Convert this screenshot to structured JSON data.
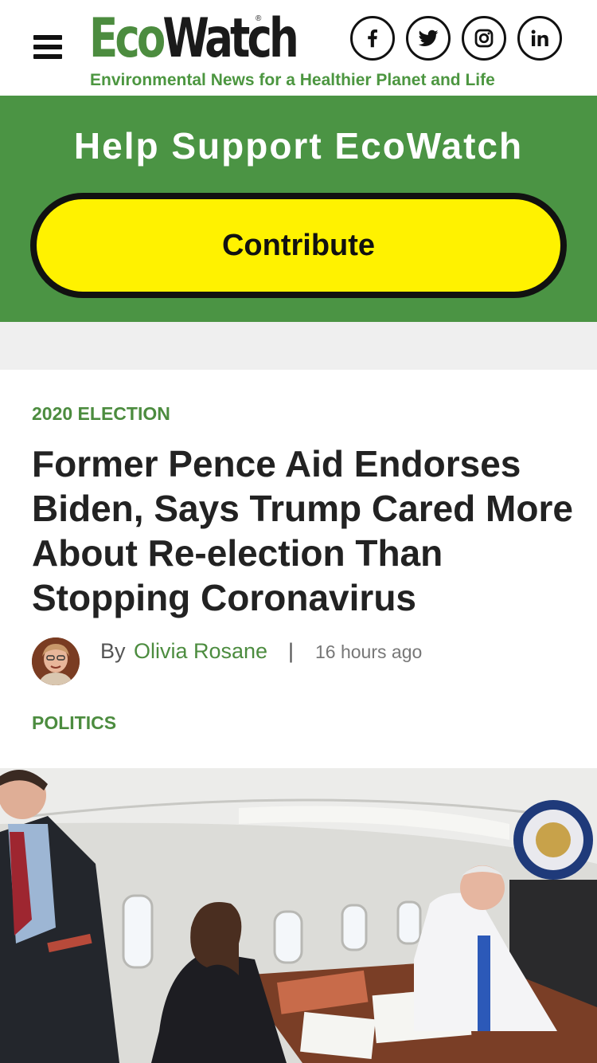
{
  "header": {
    "logo_part1": "Eco",
    "logo_part2": "Watch",
    "logo_reg": "®",
    "tagline": "Environmental News for a Healthier Planet and Life",
    "social": [
      "facebook-icon",
      "twitter-icon",
      "instagram-icon",
      "linkedin-icon"
    ]
  },
  "support": {
    "title": "Help Support EcoWatch",
    "button_label": "Contribute"
  },
  "article": {
    "category": "2020 ELECTION",
    "headline": "Former Pence Aid Endorses Biden, Says Trump Cared More About Re-election Than Stopping Coronavirus",
    "by_label": "By",
    "author": "Olivia Rosane",
    "separator": "|",
    "time": "16 hours ago",
    "tag": "POLITICS"
  },
  "colors": {
    "brand_green": "#4b9444",
    "button_yellow": "#fff200",
    "text_dark": "#222222"
  }
}
